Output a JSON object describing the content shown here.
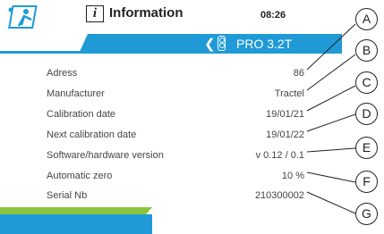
{
  "header": {
    "title": "Information",
    "time": "08:26",
    "info_icon_glyph": "i",
    "logo_icon": "person-climbing-logo-icon"
  },
  "device_bar": {
    "back_glyph": "❮",
    "device_icon": "device-icon",
    "device_name": "PRO 3.2T",
    "color": "#1f9ad6"
  },
  "rows": [
    {
      "label": "Adress",
      "value": "86",
      "callout": "A"
    },
    {
      "label": "Manufacturer",
      "value": "Tractel",
      "callout": "B"
    },
    {
      "label": "Calibration date",
      "value": "19/01/21",
      "callout": "C"
    },
    {
      "label": "Next calibration date",
      "value": "19/01/22",
      "callout": "D"
    },
    {
      "label": "Software/hardware version",
      "value": "v 0.12 / 0.1",
      "callout": "E"
    },
    {
      "label": "Automatic zero",
      "value": "10 %",
      "callout": "F"
    },
    {
      "label": "Serial Nb",
      "value": "210300002",
      "callout": "G"
    }
  ],
  "colors": {
    "accent_blue": "#1f9ad6",
    "accent_green": "#8cc63f"
  }
}
